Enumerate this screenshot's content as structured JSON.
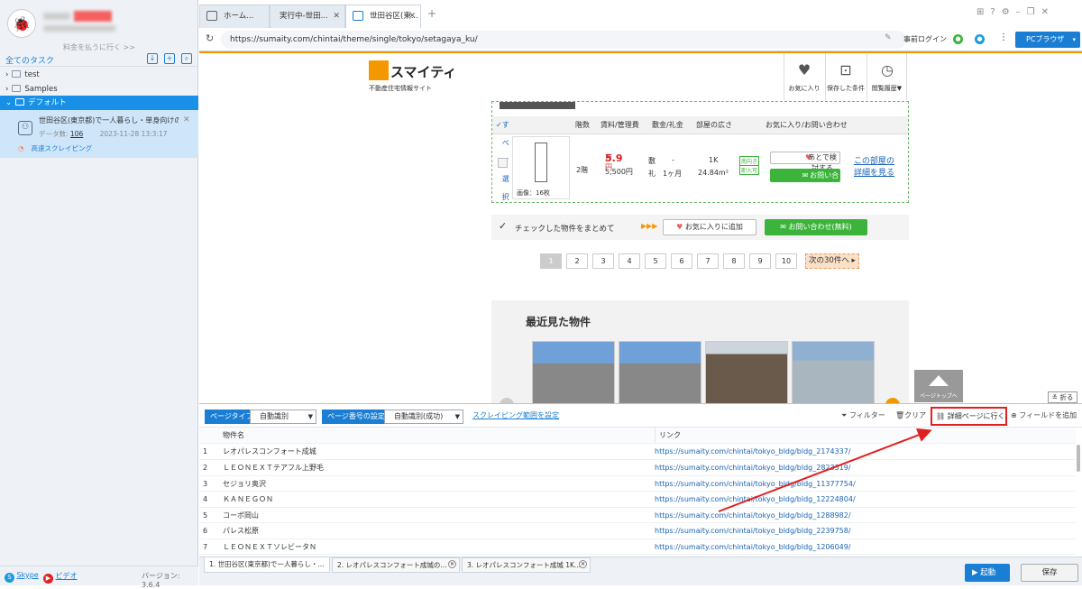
{
  "sidebar": {
    "pay_link": "料金を払うに行く >>",
    "all_tasks": "全てのタスク",
    "folders": [
      "test",
      "Samples",
      "デフォルト"
    ],
    "task": {
      "title": "世田谷区(東京都)で一人暮らし・単身向けの...",
      "data_label": "データ数:",
      "data_count": "106",
      "timestamp": "2023-11-28 13:3:17",
      "mode": "高速スクレイピング"
    },
    "skype": "Skype",
    "video": "ビデオ",
    "version": "バージョン: 3.6.4"
  },
  "tabs": [
    {
      "label": "ホーム..."
    },
    {
      "label": "実行中-世田..."
    },
    {
      "label": "世田谷区(東..."
    }
  ],
  "address": {
    "url": "https://sumaity.com/chintai/theme/single/tokyo/setagaya_ku/",
    "login": "事前ログイン",
    "browser_btn": "PCブラウザ"
  },
  "webpage": {
    "logo": "スマイティ",
    "logo_sub": "不動産住宅情報サイト",
    "nav": [
      "お気に入り",
      "保存した条件",
      "閲覧履歴▼"
    ],
    "table_header": {
      "select_all": "すべて選択",
      "floor": "階数",
      "rent": "賃料/管理費",
      "deposit": "敷金/礼金",
      "area": "部屋の広さ",
      "fav_inquiry": "お気に入り/お問い合わせ"
    },
    "row": {
      "image_count": "画像：16枚",
      "floor": "2階",
      "rent_amount": "5.9",
      "rent_unit": "万円",
      "mgmt_fee": "5,500円",
      "deposit_label1": "敷",
      "deposit_label2": "礼",
      "deposit_val1": "-",
      "deposit_val2": "1ヶ月",
      "layout": "1K",
      "size": "24.84m²",
      "tag1": "南向き",
      "tag2": "即入可",
      "consider_btn": "あとで検討する",
      "inquiry_btn": "お問い合わせ",
      "detail_link1": "この部屋の",
      "detail_link2": "詳細を見る"
    },
    "bulk_text": "チェックした物件をまとめて",
    "bulk_fav": "お気に入りに追加",
    "bulk_inquiry": "お問い合わせ(無料)",
    "pages": [
      "1",
      "2",
      "3",
      "4",
      "5",
      "6",
      "7",
      "8",
      "9",
      "10"
    ],
    "next_page": "次の30件へ",
    "recent_title": "最近見た物件",
    "page_top": "ページトップへ",
    "fold": "折る"
  },
  "toolbar": {
    "page_type_label": "ページタイプ",
    "page_type_value": "自動識別",
    "page_num_label": "ページ番号の設定",
    "page_num_value": "自動識別(成功)",
    "scrape_range": "スクレイピング範囲を設定",
    "filter": "フィルター",
    "clear": "クリア",
    "goto_detail": "詳細ページに行く",
    "add_field": "フィールドを追加"
  },
  "table": {
    "headers": [
      "物件名",
      "リンク"
    ],
    "rows": [
      {
        "n": "1",
        "name": "レオパレスコンフォート成城",
        "link": "https://sumaity.com/chintai/tokyo_bldg/bldg_2174337/"
      },
      {
        "n": "2",
        "name": "ＬＥＯＮＥＸＴテアフル上野毛",
        "link": "https://sumaity.com/chintai/tokyo_bldg/bldg_2823319/"
      },
      {
        "n": "3",
        "name": "セジョリ奥沢",
        "link": "https://sumaity.com/chintai/tokyo_bldg/bldg_11377754/"
      },
      {
        "n": "4",
        "name": "ＫＡＮＥＧＯＮ",
        "link": "https://sumaity.com/chintai/tokyo_bldg/bldg_12224804/"
      },
      {
        "n": "5",
        "name": "コーポ岡山",
        "link": "https://sumaity.com/chintai/tokyo_bldg/bldg_1288982/"
      },
      {
        "n": "6",
        "name": "パレス松原",
        "link": "https://sumaity.com/chintai/tokyo_bldg/bldg_2239758/"
      },
      {
        "n": "7",
        "name": "ＬＥＯＮＥＸＴソレビータＮ",
        "link": "https://sumaity.com/chintai/tokyo_bldg/bldg_1206049/"
      }
    ]
  },
  "bottom_tabs": [
    "1. 世田谷区(東京都)で一人暮らし・...",
    "2. レオパレスコンフォート成城の...",
    "3. レオパレスコンフォート成城 1K..."
  ],
  "run_btn": "起動",
  "save_btn": "保存",
  "colors": {
    "accent": "#1a7fd4",
    "brand_orange": "#f39800",
    "highlight_red": "#e02020",
    "green": "#3cb43c"
  }
}
